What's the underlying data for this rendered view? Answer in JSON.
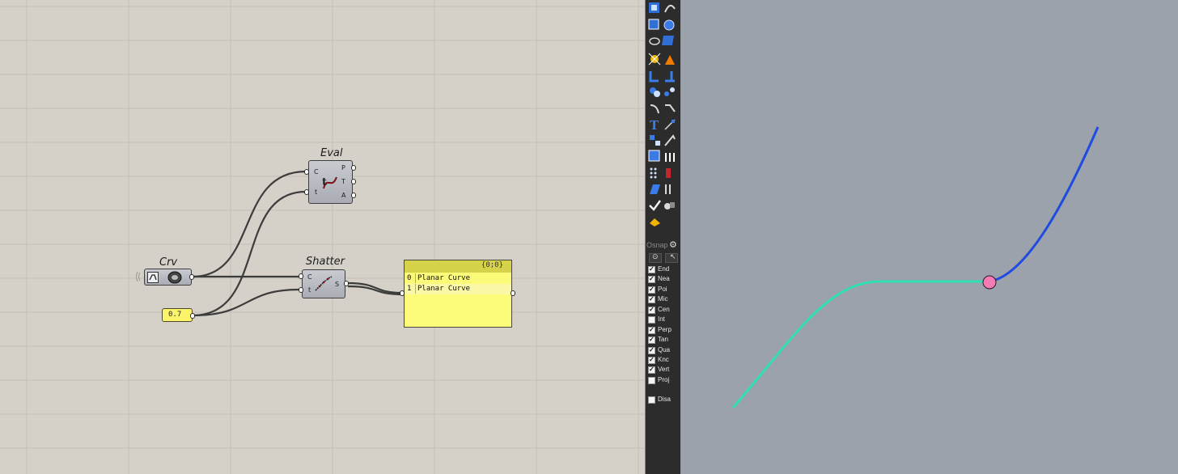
{
  "canvas": {
    "components": {
      "eval": {
        "title": "Eval",
        "inputs": [
          "C",
          "t"
        ],
        "outputs": [
          "P",
          "T",
          "A"
        ],
        "icon": "evaluate-curve-icon"
      },
      "crv": {
        "title": "Crv",
        "icon": "curve-param-icon"
      },
      "shatter": {
        "title": "Shatter",
        "inputs": [
          "C",
          "t"
        ],
        "outputs": [
          "S"
        ],
        "icon": "shatter-icon"
      },
      "number": {
        "value": "0.7"
      },
      "panel": {
        "path": "{0;0}",
        "rows": [
          {
            "index": "0",
            "value": "Planar Curve"
          },
          {
            "index": "1",
            "value": "Planar Curve"
          }
        ]
      }
    },
    "colors": {
      "background": "#d5d1c9",
      "panel": "#fdfb7a",
      "wire": "#3c3c3c"
    }
  },
  "sidebar": {
    "osnap_title": "Osnap",
    "osnap_items": [
      {
        "label": "End",
        "checked": true
      },
      {
        "label": "Nea",
        "checked": true
      },
      {
        "label": "Poi",
        "checked": true
      },
      {
        "label": "Mic",
        "checked": true
      },
      {
        "label": "Cen",
        "checked": true
      },
      {
        "label": "Int",
        "checked": false
      },
      {
        "label": "Perp",
        "checked": true
      },
      {
        "label": "Tan",
        "checked": true
      },
      {
        "label": "Qua",
        "checked": true
      },
      {
        "label": "Knc",
        "checked": true
      },
      {
        "label": "Vert",
        "checked": true
      },
      {
        "label": "Proj",
        "checked": false
      },
      {
        "label": "Disa",
        "checked": false
      }
    ]
  },
  "viewport": {
    "colors": {
      "background": "#9ba2ab",
      "curve_segment_1": "#2fe0b2",
      "curve_segment_2": "#1f4be0",
      "split_point": "#f47bb4"
    }
  }
}
